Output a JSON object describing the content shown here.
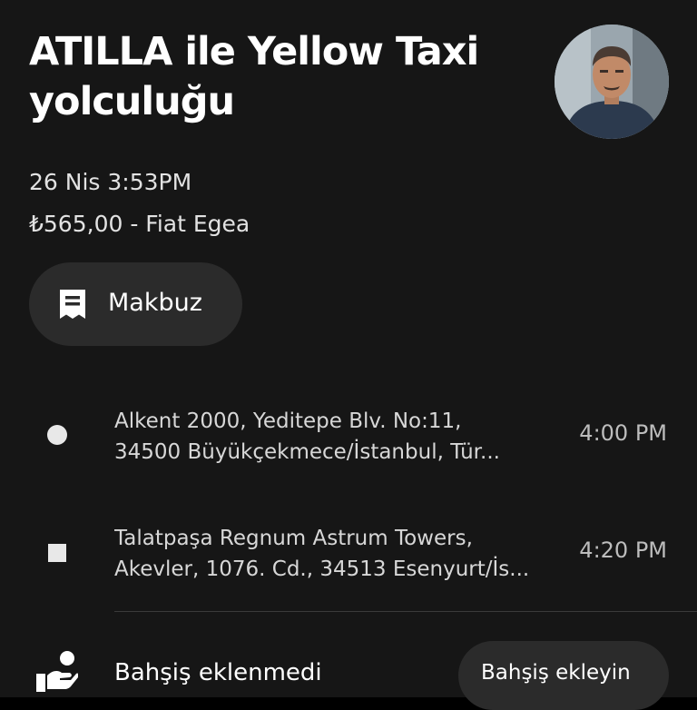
{
  "trip": {
    "title": "ATILLA ile Yellow Taxi yolculuğu",
    "date_time": "26 Nis 3:53PM",
    "fare_vehicle": "₺565,00 - Fiat Egea"
  },
  "receipt_button": {
    "label": "Makbuz",
    "icon": "receipt-icon"
  },
  "stops": [
    {
      "icon": "pickup-dot-icon",
      "address_line1": "Alkent 2000, Yeditepe Blv. No:11,",
      "address_line2": "34500 Büyükçekmece/İstanbul, Tür...",
      "time": "4:00 PM"
    },
    {
      "icon": "dropoff-square-icon",
      "address_line1": "Talatpaşa Regnum Astrum Towers,",
      "address_line2": "Akevler, 1076. Cd., 34513 Esenyurt/İs...",
      "time": "4:20 PM"
    }
  ],
  "tip": {
    "status": "Bahşiş eklenmedi",
    "button_label": "Bahşiş ekleyin",
    "icon": "tip-hand-icon"
  },
  "colors": {
    "background": "#161616",
    "button_bg": "#2b2b2b",
    "text_primary": "#ffffff",
    "text_secondary": "#d7d7d7"
  }
}
